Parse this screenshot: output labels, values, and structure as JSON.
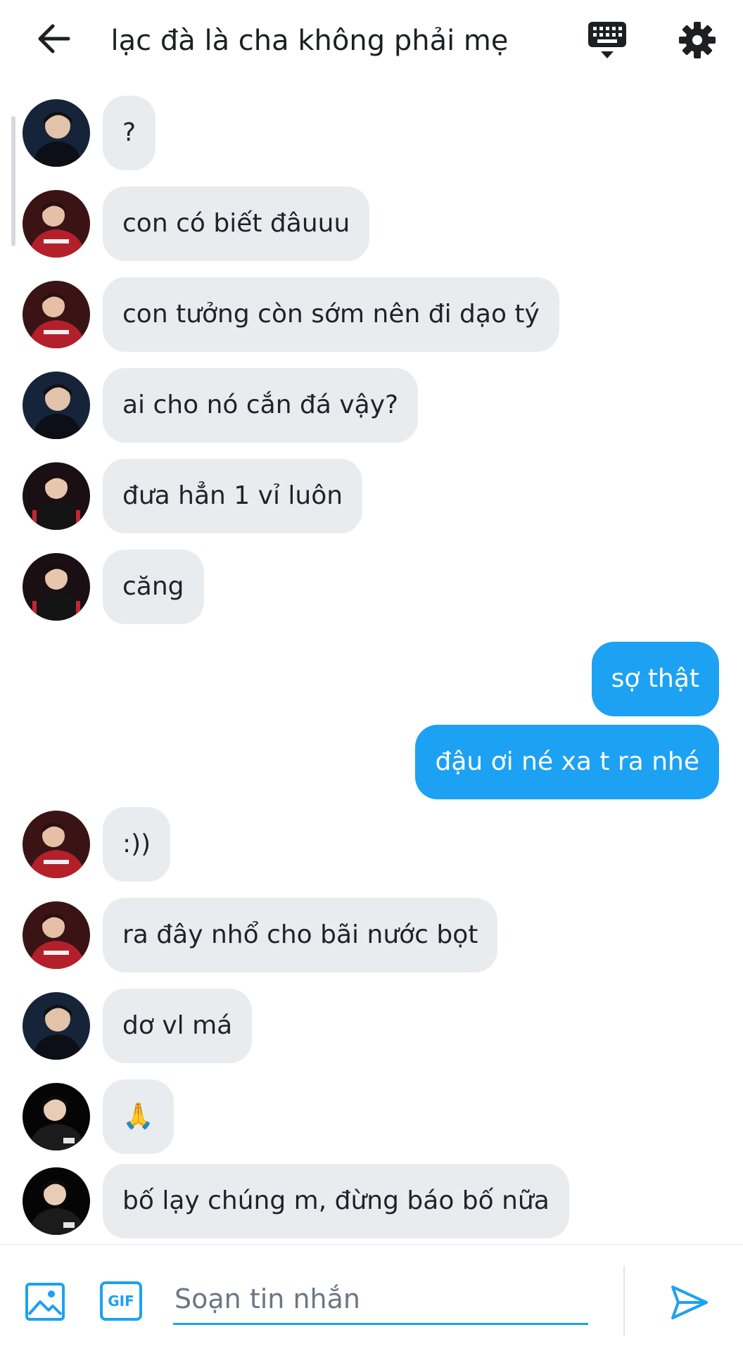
{
  "header": {
    "title": "lạc đà là cha không phải mẹ",
    "back_icon": "arrow-left-icon",
    "keyboard_icon": "keyboard-icon",
    "settings_icon": "gear-icon"
  },
  "messages": [
    {
      "dir": "in",
      "text": "?",
      "avatar": "avatar-dark-jacket"
    },
    {
      "dir": "in",
      "text": "con có biết đâuuu",
      "avatar": "avatar-red-jersey"
    },
    {
      "dir": "in",
      "text": " con tưởng còn sớm nên đi dạo tý",
      "avatar": "avatar-red-jersey"
    },
    {
      "dir": "in",
      "text": "ai cho nó cắn đá vậy?",
      "avatar": "avatar-dark-jacket"
    },
    {
      "dir": "in",
      "text": "đưa hẳn 1 vỉ luôn",
      "avatar": "avatar-black-red-stripe"
    },
    {
      "dir": "in",
      "text": "căng",
      "avatar": "avatar-black-red-stripe"
    },
    {
      "dir": "out",
      "text": "sợ thật"
    },
    {
      "dir": "out",
      "text": "đậu ơi né xa t ra nhé"
    },
    {
      "dir": "in",
      "text": ":))",
      "avatar": "avatar-red-jersey"
    },
    {
      "dir": "in",
      "text": "ra đây nhổ cho bãi nước bọt",
      "avatar": "avatar-red-jersey"
    },
    {
      "dir": "in",
      "text": "dơ vl má",
      "avatar": "avatar-dark-jacket"
    },
    {
      "dir": "in",
      "text": "🙏",
      "avatar": "avatar-black-hoodie"
    },
    {
      "dir": "in",
      "text": "bố lạy chúng m, đừng báo bố nữa",
      "avatar": "avatar-black-hoodie"
    }
  ],
  "composer": {
    "placeholder": "Soạn tin nhắn",
    "gif_label": "GIF",
    "image_icon": "image-icon",
    "send_icon": "send-icon"
  },
  "colors": {
    "accent": "#1da1f2",
    "incoming_bubble": "#e9ecef",
    "outgoing_text": "#ffffff"
  }
}
